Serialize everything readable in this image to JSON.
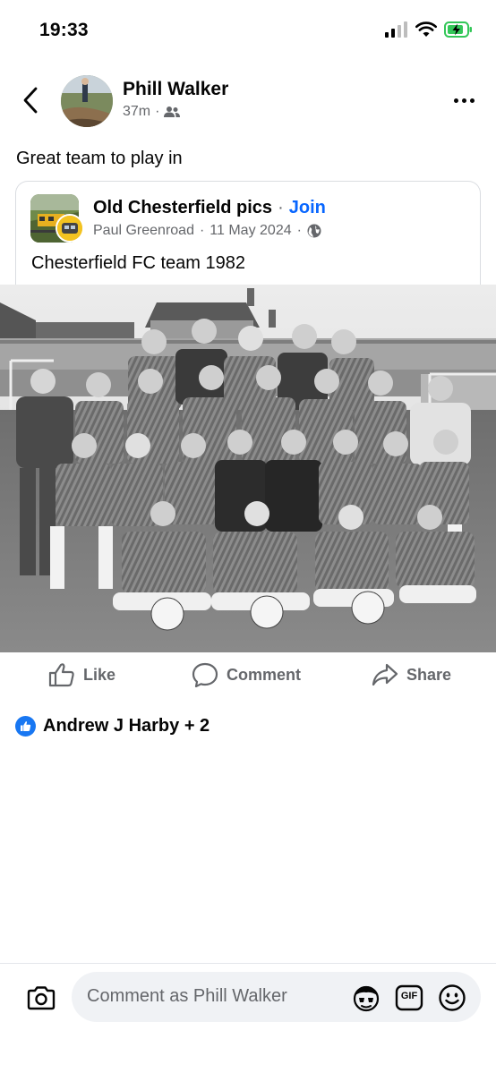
{
  "status_bar": {
    "time": "19:33"
  },
  "post": {
    "author": "Phill Walker",
    "timestamp": "37m",
    "audience_icon": "friends-icon",
    "text": "Great team to play in"
  },
  "shared": {
    "group_name": "Old Chesterfield pics",
    "separator": "·",
    "join_label": "Join",
    "poster": "Paul Greenroad",
    "date": "11 May 2024",
    "privacy_icon": "globe-icon",
    "text": "Chesterfield FC team 1982"
  },
  "actions": {
    "like": "Like",
    "comment": "Comment",
    "share": "Share"
  },
  "reactions": {
    "summary": "Andrew J Harby + 2"
  },
  "composer": {
    "placeholder": "Comment as Phill Walker",
    "gif_label": "GIF"
  },
  "colors": {
    "accent": "#0866ff",
    "muted": "#65676b",
    "battery": "#34c759"
  }
}
